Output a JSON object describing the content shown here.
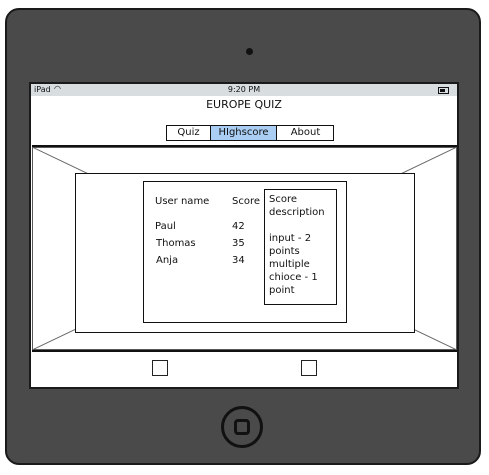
{
  "status_bar": {
    "carrier": "iPad",
    "time": "9:20 PM"
  },
  "app": {
    "title": "EUROPE QUIZ"
  },
  "tabs": [
    {
      "label": "Quiz",
      "active": false
    },
    {
      "label": "HIghscore",
      "active": true
    },
    {
      "label": "About",
      "active": false
    }
  ],
  "highscore": {
    "headers": {
      "user": "User name",
      "score": "Score"
    },
    "rows": [
      {
        "name": "Paul",
        "score": "42"
      },
      {
        "name": "Thomas",
        "score": "35"
      },
      {
        "name": "Anja",
        "score": "34"
      }
    ]
  },
  "score_description": {
    "lines": [
      "Score",
      "description",
      "",
      "input - 2",
      "points",
      "multiple",
      "chioce - 1",
      "point"
    ]
  },
  "colors": {
    "active_tab": "#a9cdf3",
    "device": "#4a4a4a",
    "status_bar": "#d8dde0"
  }
}
